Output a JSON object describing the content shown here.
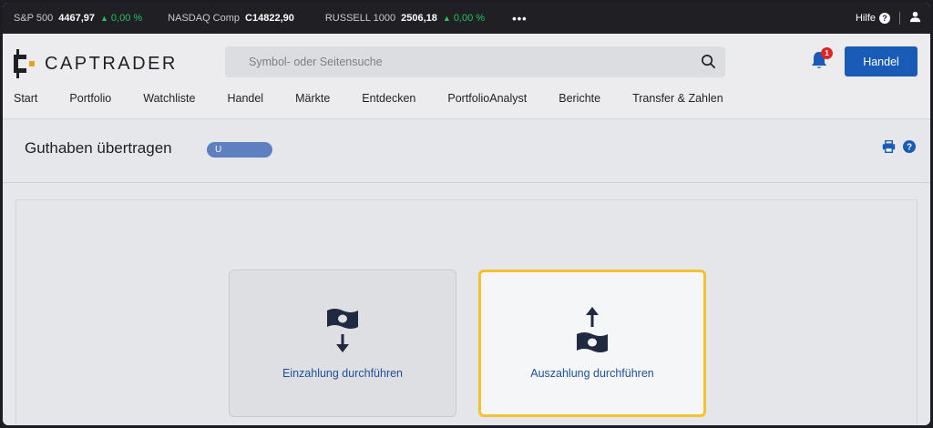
{
  "ticker": {
    "items": [
      {
        "name": "S&P 500",
        "value": "4467,97",
        "change": "0,00 %"
      },
      {
        "name": "NASDAQ Comp",
        "value": "C14822,90",
        "change": ""
      },
      {
        "name": "RUSSELL 1000",
        "value": "2506,18",
        "change": "0,00 %"
      }
    ],
    "more": "•••",
    "help_label": "Hilfe",
    "help_icon": "?",
    "colors": {
      "up": "#22c55e"
    }
  },
  "header": {
    "logo_text": "CAPTRADER",
    "search_placeholder": "Symbol- oder Seitensuche",
    "notification_count": "1",
    "trade_button": "Handel",
    "accent": "#1b5bb8"
  },
  "nav": {
    "items": [
      "Start",
      "Portfolio",
      "Watchliste",
      "Handel",
      "Märkte",
      "Entdecken",
      "PortfolioAnalyst",
      "Berichte",
      "Transfer & Zahlen"
    ]
  },
  "page": {
    "title": "Guthaben übertragen",
    "account_badge": "U"
  },
  "cards": {
    "deposit_label": "Einzahlung durchführen",
    "withdraw_label": "Auszahlung durchführen"
  }
}
